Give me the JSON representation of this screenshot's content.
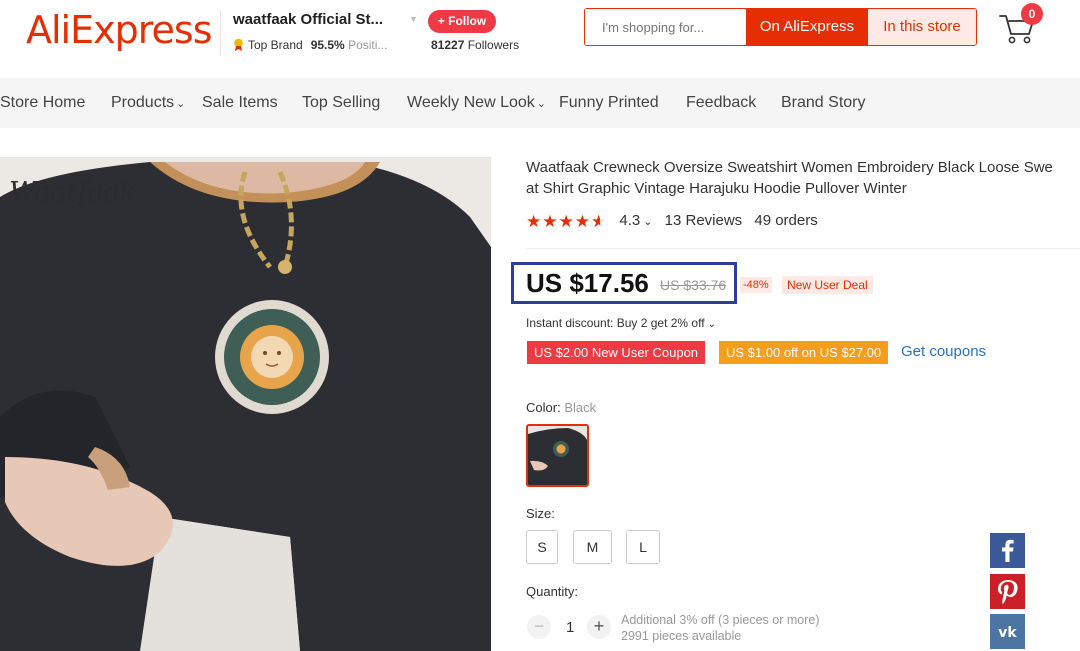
{
  "header": {
    "logo": "AliExpress",
    "store_name": "waatfaak Official St...",
    "follow_label": "+ Follow",
    "badge_label": "Top Brand",
    "positive_value": "95.5%",
    "positive_label": "Positi...",
    "followers_count": "81227",
    "followers_label": "Followers",
    "search_placeholder": "I'm shopping for...",
    "search_on_ae": "On AliExpress",
    "search_in_store": "In this store",
    "cart_count": "0"
  },
  "nav": {
    "items": [
      {
        "label": "Store Home"
      },
      {
        "label": "Products",
        "icon": "chevron-down-icon"
      },
      {
        "label": "Sale Items"
      },
      {
        "label": "Top Selling"
      },
      {
        "label": "Weekly New Look",
        "icon": "chevron-down-icon"
      },
      {
        "label": "Funny Printed"
      },
      {
        "label": "Feedback"
      },
      {
        "label": "Brand Story"
      }
    ]
  },
  "product": {
    "brand_watermark": "Waatfaak",
    "title": "Waatfaak Crewneck Oversize Sweatshirt Women Embroidery Black Loose Swe\nat Shirt Graphic Vintage Harajuku Hoodie Pullover Winter",
    "rating_value": "4.3",
    "rating_stars": 4.3,
    "reviews": "13 Reviews",
    "orders": "49 orders",
    "price": "US $17.56",
    "old_price": "US $33.76",
    "discount": "-48%",
    "new_user_deal": "New User Deal",
    "instant_discount": "Instant discount: Buy 2 get 2% off",
    "coupon_1": "US $2.00 New User Coupon",
    "coupon_2": "US $1.00 off on US $27.00",
    "get_coupons": "Get coupons",
    "color_label": "Color:",
    "color_value": "Black",
    "size_label": "Size:",
    "sizes": [
      "S",
      "M",
      "L"
    ],
    "quantity_label": "Quantity:",
    "quantity": "1",
    "qty_note_1": "Additional 3% off (3 pieces or more)",
    "qty_note_2": "2991 pieces available"
  },
  "colors": {
    "brand": "#e62e04",
    "highlight_box": "#2d3d9b",
    "coupon_red": "#ee3a44",
    "coupon_orange": "#f59e1b",
    "link": "#2874c4"
  },
  "social": [
    "facebook-icon",
    "pinterest-icon",
    "vk-icon"
  ]
}
